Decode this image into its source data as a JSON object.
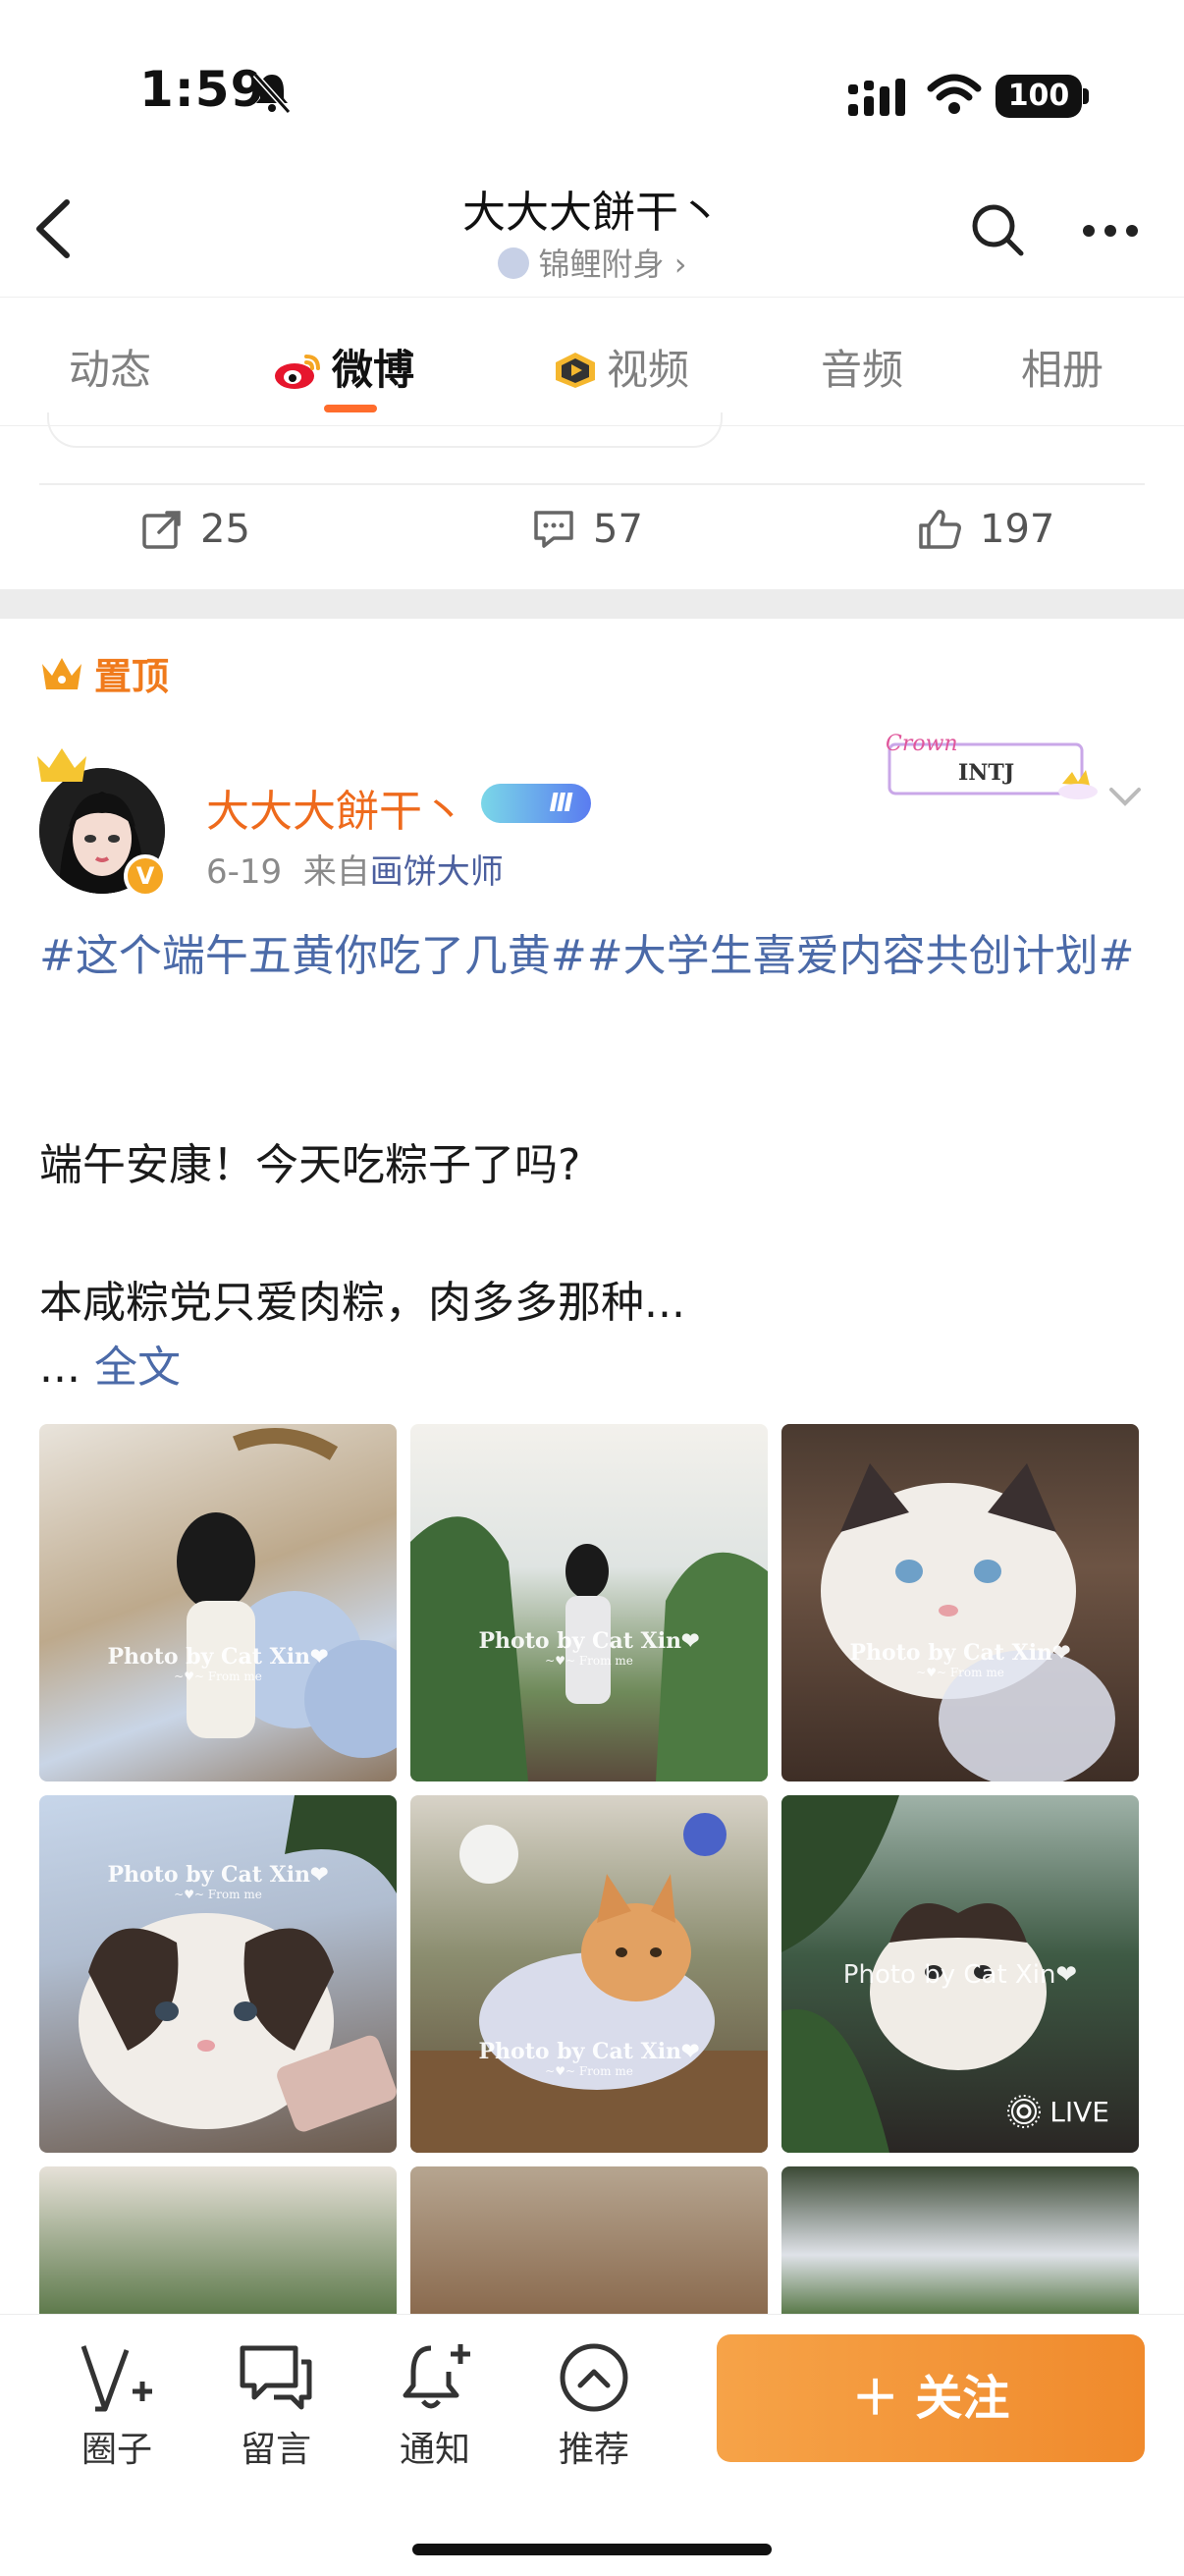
{
  "status_bar": {
    "time": "1:59",
    "battery": "100"
  },
  "header": {
    "title": "大大大餅干丶",
    "subtitle": "锦鲤附身",
    "subtitle_arrow": "›"
  },
  "tabs": [
    {
      "label": "动态",
      "active": false
    },
    {
      "label": "微博",
      "active": true
    },
    {
      "label": "视频",
      "active": false
    },
    {
      "label": "音频",
      "active": false
    },
    {
      "label": "相册",
      "active": false
    }
  ],
  "stats": {
    "reposts": "25",
    "comments": "57",
    "likes": "197"
  },
  "pinned_label": "置顶",
  "post": {
    "author": "大大大餅干丶",
    "level_badge": "Ⅲ",
    "date": "6-19",
    "source_prefix": "来自",
    "source": "画饼大师",
    "mbti_card": {
      "title": "Crown",
      "type": "INTJ"
    },
    "topic": "#这个端午五黄你吃了几黄##大学生喜爱内容共创计划#",
    "para1": "端午安康！今天吃粽子了吗?",
    "para2": "本咸粽党只爱肉粽，肉多多那种...",
    "more_prefix": "... ",
    "more_link": "全文",
    "watermark": "Photo by Cat Xin❤",
    "watermark_sub": "~♥~ From me",
    "live_label": "LIVE"
  },
  "bottom_bar": {
    "items": [
      {
        "label": "圈子",
        "icon": "circle-v-plus-icon"
      },
      {
        "label": "留言",
        "icon": "message-bubbles-icon"
      },
      {
        "label": "通知",
        "icon": "bell-plus-icon"
      },
      {
        "label": "推荐",
        "icon": "chevron-up-circle-icon"
      }
    ],
    "follow_label": "＋ 关注"
  },
  "colors": {
    "accent": "#ff6c2c",
    "link": "#4b6aa8",
    "author": "#ee6a1c",
    "follow": "#f08a2c"
  }
}
